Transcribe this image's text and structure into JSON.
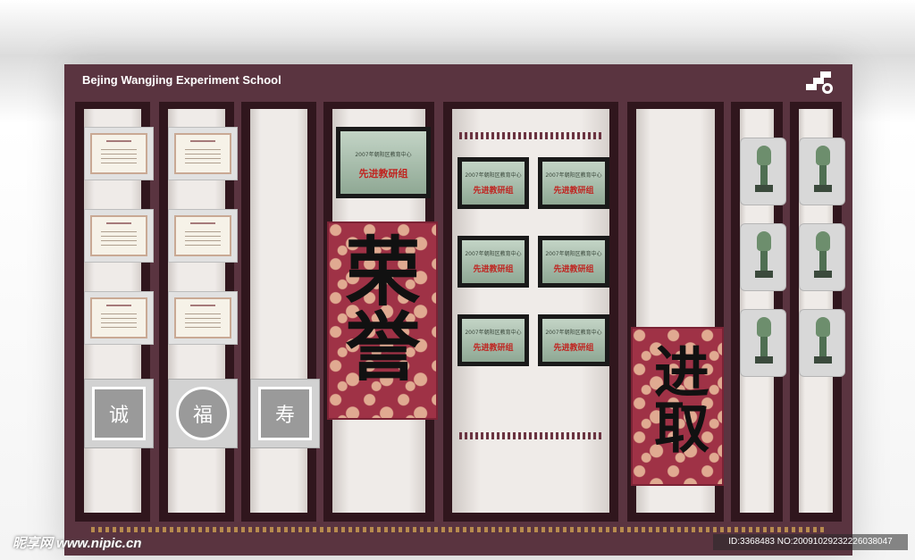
{
  "header": {
    "title": "Bejing Wangjing Experiment School",
    "logo_icon": "school-logo-icon"
  },
  "plaques": {
    "top_main": "先进教研组",
    "grid_main": "先进教研组",
    "line2": "2007年朝阳区教育中心"
  },
  "banners": {
    "honor_chars": "荣誉",
    "progress_chars": "进取"
  },
  "seals": [
    "诚",
    "福",
    "寿"
  ],
  "colors": {
    "frame": "#5a3440",
    "banner": "#9f3246",
    "accent": "#c0231f"
  },
  "watermark": {
    "site": "昵享网 www.nipic.cn",
    "id": "ID:3368483 NO:20091029232226038047"
  }
}
